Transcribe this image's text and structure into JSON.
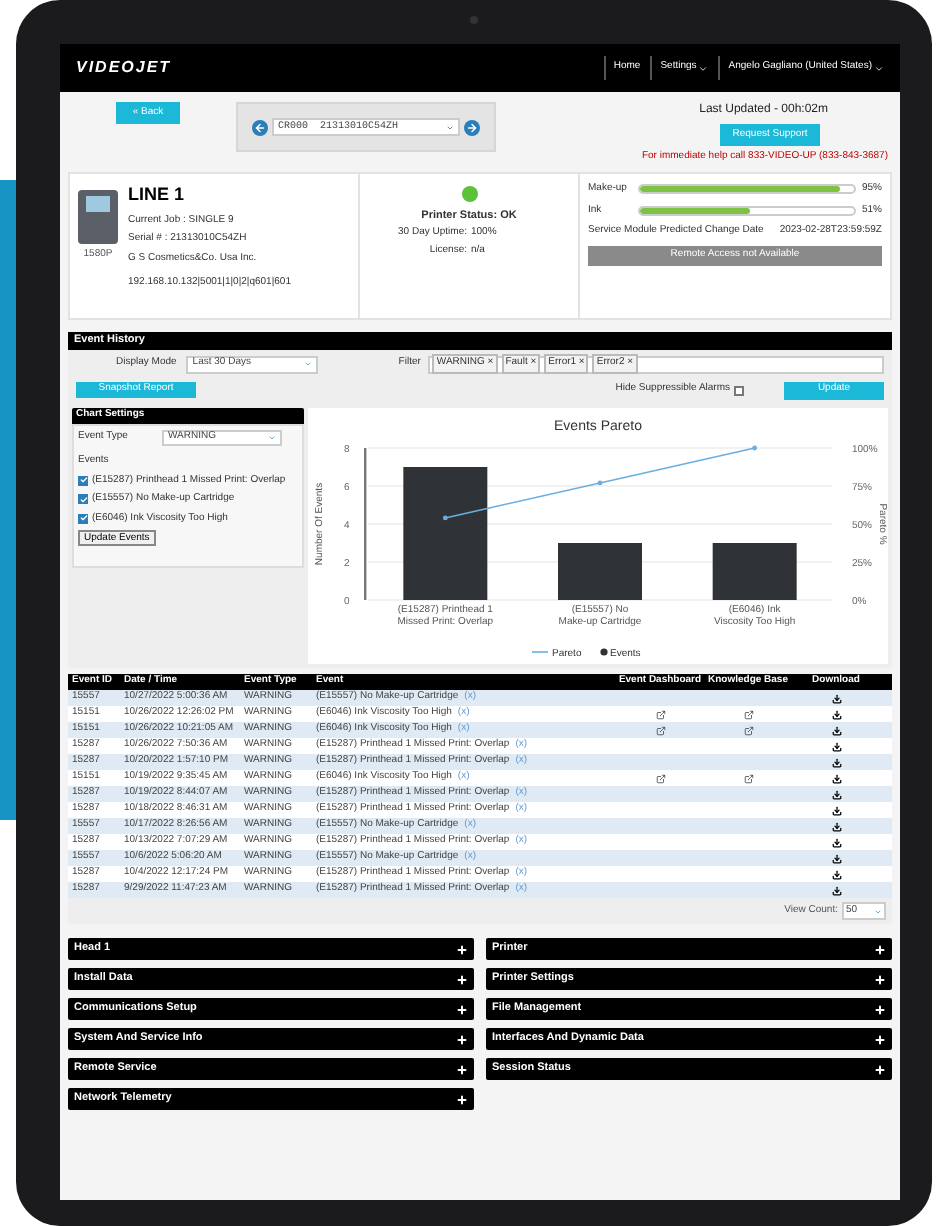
{
  "nav": {
    "logo": "VIDEOJET",
    "links": [
      {
        "label": "Home",
        "dropdown": false
      },
      {
        "label": "Settings",
        "dropdown": true
      },
      {
        "label": "Angelo Gagliano (United States)",
        "dropdown": true
      }
    ]
  },
  "toolbar": {
    "back": "« Back",
    "printer_select": "CR000  21313010C54ZH",
    "last_updated": "Last Updated - 00h:02m",
    "request_support": "Request Support",
    "help": "For immediate help call 833-VIDEO-UP (833-843-3687)"
  },
  "printer": {
    "model": "1580P",
    "name": "LINE 1",
    "job": "Current Job : SINGLE 9",
    "serial": "Serial # : 21313010C54ZH",
    "company": "G S Cosmetics&Co. Usa Inc.",
    "address": "192.168.10.132|5001|1|0|2|q601|601"
  },
  "status": {
    "ok": true,
    "label": "Printer Status: OK",
    "rows": [
      {
        "label": "30 Day Uptime:",
        "value": "100%"
      },
      {
        "label": "License:",
        "value": "n/a"
      }
    ]
  },
  "supplies": {
    "meters": [
      {
        "label": "Make-up",
        "level": 0.93,
        "reading": "95%"
      },
      {
        "label": "Ink",
        "level": 0.51,
        "reading": "51%"
      }
    ],
    "change_label": "Service Module Predicted Change Date",
    "change_date": "2023-02-28T23:59:59Z",
    "remote_access": {
      "label": "Remote Access not Available",
      "disabled": true
    }
  },
  "event_history": {
    "title": "Event History",
    "display_mode_label": "Display Mode",
    "display_mode": "Last 30 Days",
    "filter_label": "Filter",
    "filters": [
      {
        "label": "WARNING",
        "remove": "×"
      },
      {
        "label": "Fault",
        "remove": "×"
      },
      {
        "label": "Error1",
        "remove": "×"
      },
      {
        "label": "Error2",
        "remove": "×"
      }
    ],
    "snapshot": "Snapshot Report",
    "hide_label": "Hide Suppressible Alarms",
    "hide_checked": false,
    "update": "Update"
  },
  "chart_settings": {
    "title": "Chart Settings",
    "event_type_label": "Event Type",
    "event_type": "WARNING",
    "events_label": "Events",
    "events": [
      {
        "label": "(E15287) Printhead 1 Missed Print: Overlap",
        "checked": true
      },
      {
        "label": "(E15557) No Make-up Cartridge",
        "checked": true
      },
      {
        "label": "(E6046) Ink Viscosity Too High",
        "checked": true
      }
    ],
    "update_events": "Update Events"
  },
  "chart": {
    "bars": {
      "chart_data": {
        "type": "bar",
        "title": "Events Pareto",
        "ylabel": "Number Of Events",
        "categories": [
          "(E15287) Printhead 1 Missed Print: Overlap",
          "(E15557) No Make-up Cartridge",
          "(E6046) Ink Viscosity Too High"
        ],
        "series": [
          {
            "name": "Events",
            "color": "#2f3237",
            "values": [
              7,
              3,
              3
            ]
          }
        ],
        "ylim": [
          0,
          8
        ],
        "yticks": [
          0,
          2,
          4,
          6,
          8
        ],
        "grid": true
      }
    },
    "pareto": {
      "chart_data": {
        "type": "line",
        "ylabel": "Pareto %",
        "series": [
          {
            "name": "Pareto",
            "color": "#6aaee0",
            "values": [
              54,
              77,
              100
            ]
          }
        ],
        "ylim": [
          0,
          100
        ],
        "yticks": [
          {
            "value": 0,
            "label": "0%"
          },
          {
            "value": 25,
            "label": "25%"
          },
          {
            "value": 50,
            "label": "50%"
          },
          {
            "value": 75,
            "label": "75%"
          },
          {
            "value": 100,
            "label": "100%"
          }
        ]
      }
    }
  },
  "table": {
    "columns": [
      "Event ID",
      "Date / Time",
      "Event Type",
      "Event",
      "Event Dashboard",
      "Knowledge Base",
      "Download"
    ],
    "rows": [
      {
        "id": "15557",
        "time": "10/27/2022 5:00:36 AM",
        "type": "WARNING",
        "event": "(E15557) No Make-up Cartridge",
        "x": "(x)",
        "dashboard": false,
        "kb": false
      },
      {
        "id": "15151",
        "time": "10/26/2022 12:26:02 PM",
        "type": "WARNING",
        "event": "(E6046) Ink Viscosity Too High",
        "x": "(x)",
        "dashboard": true,
        "kb": true
      },
      {
        "id": "15151",
        "time": "10/26/2022 10:21:05 AM",
        "type": "WARNING",
        "event": "(E6046) Ink Viscosity Too High",
        "x": "(x)",
        "dashboard": true,
        "kb": true
      },
      {
        "id": "15287",
        "time": "10/26/2022 7:50:36 AM",
        "type": "WARNING",
        "event": "(E15287) Printhead 1 Missed Print: Overlap",
        "x": "(x)",
        "dashboard": false,
        "kb": false
      },
      {
        "id": "15287",
        "time": "10/20/2022 1:57:10 PM",
        "type": "WARNING",
        "event": "(E15287) Printhead 1 Missed Print: Overlap",
        "x": "(x)",
        "dashboard": false,
        "kb": false
      },
      {
        "id": "15151",
        "time": "10/19/2022 9:35:45 AM",
        "type": "WARNING",
        "event": "(E6046) Ink Viscosity Too High",
        "x": "(x)",
        "dashboard": true,
        "kb": true
      },
      {
        "id": "15287",
        "time": "10/19/2022 8:44:07 AM",
        "type": "WARNING",
        "event": "(E15287) Printhead 1 Missed Print: Overlap",
        "x": "(x)",
        "dashboard": false,
        "kb": false
      },
      {
        "id": "15287",
        "time": "10/18/2022 8:46:31 AM",
        "type": "WARNING",
        "event": "(E15287) Printhead 1 Missed Print: Overlap",
        "x": "(x)",
        "dashboard": false,
        "kb": false
      },
      {
        "id": "15557",
        "time": "10/17/2022 8:26:56 AM",
        "type": "WARNING",
        "event": "(E15557) No Make-up Cartridge",
        "x": "(x)",
        "dashboard": false,
        "kb": false
      },
      {
        "id": "15287",
        "time": "10/13/2022 7:07:29 AM",
        "type": "WARNING",
        "event": "(E15287) Printhead 1 Missed Print: Overlap",
        "x": "(x)",
        "dashboard": false,
        "kb": false
      },
      {
        "id": "15557",
        "time": "10/6/2022 5:06:20 AM",
        "type": "WARNING",
        "event": "(E15557) No Make-up Cartridge",
        "x": "(x)",
        "dashboard": false,
        "kb": false
      },
      {
        "id": "15287",
        "time": "10/4/2022 12:17:24 PM",
        "type": "WARNING",
        "event": "(E15287) Printhead 1 Missed Print: Overlap",
        "x": "(x)",
        "dashboard": false,
        "kb": false
      },
      {
        "id": "15287",
        "time": "9/29/2022 11:47:23 AM",
        "type": "WARNING",
        "event": "(E15287) Printhead 1 Missed Print: Overlap",
        "x": "(x)",
        "dashboard": false,
        "kb": false
      }
    ],
    "view_count_label": "View Count:",
    "view_count": "50"
  },
  "sections": {
    "left": [
      {
        "label": "Head 1",
        "expanded": false
      },
      {
        "label": "Install Data",
        "expanded": false
      },
      {
        "label": "Communications Setup",
        "expanded": false
      },
      {
        "label": "System And Service Info",
        "expanded": false
      },
      {
        "label": "Remote Service",
        "expanded": false
      },
      {
        "label": "Network Telemetry",
        "expanded": false
      }
    ],
    "right": [
      {
        "label": "Printer",
        "expanded": false
      },
      {
        "label": "Printer Settings",
        "expanded": false
      },
      {
        "label": "File Management",
        "expanded": false
      },
      {
        "label": "Interfaces And Dynamic Data",
        "expanded": false
      },
      {
        "label": "Session Status",
        "expanded": false
      }
    ]
  }
}
